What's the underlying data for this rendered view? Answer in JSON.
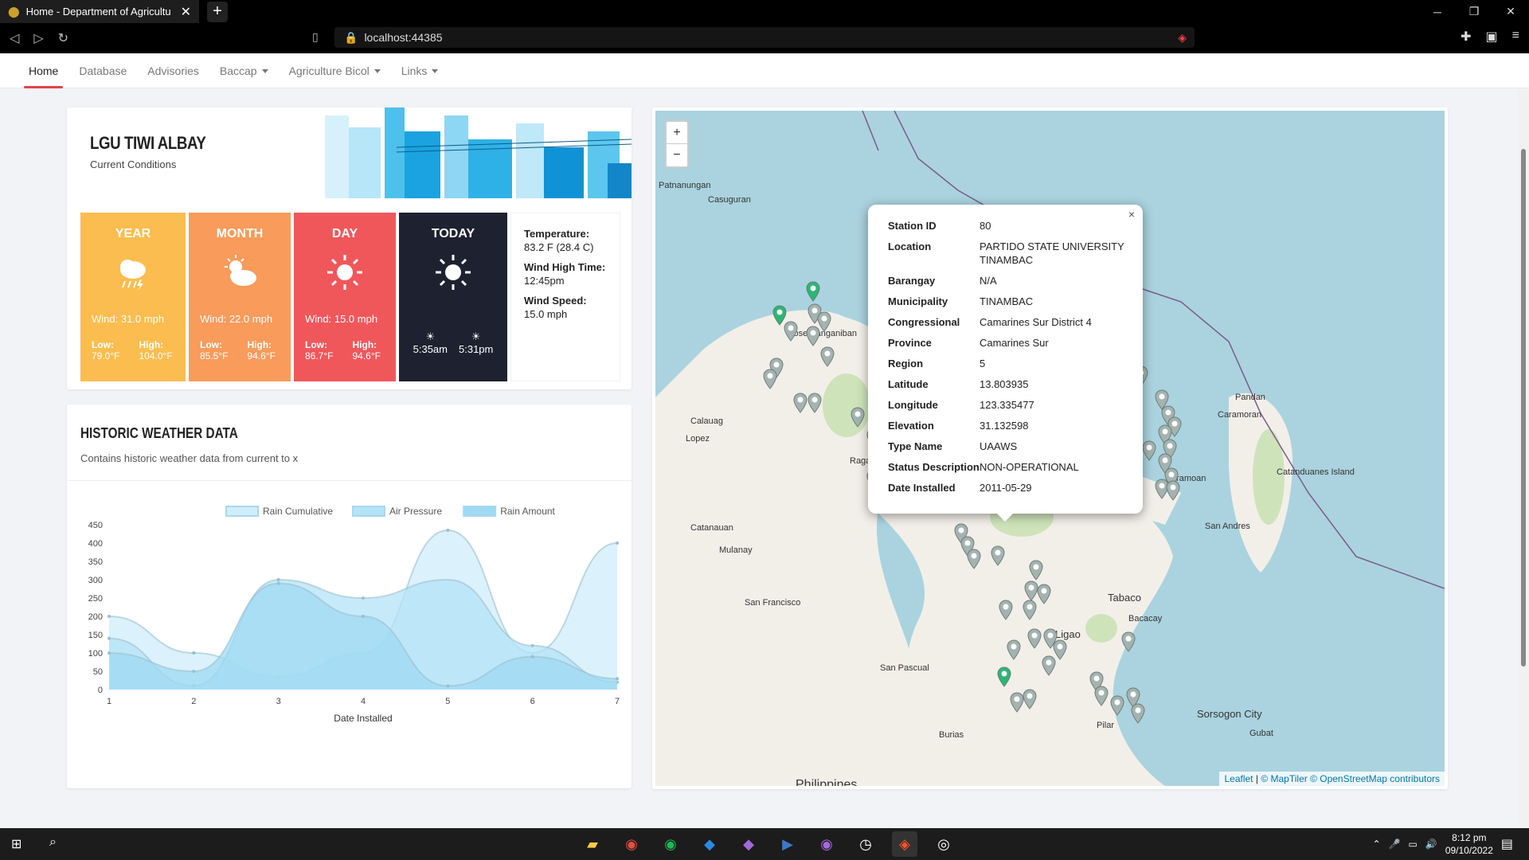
{
  "browser": {
    "tab_title": "Home - Department of Agricultu",
    "url": "localhost:44385"
  },
  "nav": {
    "items": [
      {
        "label": "Home"
      },
      {
        "label": "Database"
      },
      {
        "label": "Advisories"
      },
      {
        "label": "Baccap"
      },
      {
        "label": "Agriculture Bicol"
      },
      {
        "label": "Links"
      }
    ]
  },
  "lgu": {
    "title": "LGU TIWI ALBAY",
    "subtitle": "Current Conditions",
    "year": {
      "title": "YEAR",
      "wind": "Wind: 31.0 mph",
      "low_label": "Low:",
      "low": "79.0°F",
      "high_label": "High:",
      "high": "104.0°F"
    },
    "month": {
      "title": "MONTH",
      "wind": "Wind: 22.0 mph",
      "low_label": "Low:",
      "low": "85.5°F",
      "high_label": "High:",
      "high": "94.6°F"
    },
    "day": {
      "title": "DAY",
      "wind": "Wind: 15.0 mph",
      "low_label": "Low:",
      "low": "86.7°F",
      "high_label": "High:",
      "high": "94.6°F"
    },
    "today": {
      "title": "TODAY",
      "sunrise": "5:35am",
      "sunset": "5:31pm"
    },
    "stats": {
      "temp_label": "Temperature:",
      "temp": "83.2 F (28.4 C)",
      "wind_time_label": "Wind High Time:",
      "wind_time": "12:45pm",
      "wind_speed_label": "Wind Speed:",
      "wind_speed": "15.0 mph"
    }
  },
  "history": {
    "title": "HISTORIC WEATHER DATA",
    "subtitle": "Contains historic weather data from current to x"
  },
  "chart_data": {
    "type": "area",
    "x": [
      1,
      2,
      3,
      4,
      5,
      6,
      7
    ],
    "series": [
      {
        "name": "Rain Cumulative",
        "values": [
          200,
          100,
          35,
          100,
          435,
          100,
          400
        ]
      },
      {
        "name": "Air Pressure",
        "values": [
          140,
          10,
          300,
          250,
          300,
          120,
          20
        ]
      },
      {
        "name": "Rain Amount",
        "values": [
          100,
          50,
          290,
          200,
          10,
          90,
          30
        ]
      }
    ],
    "xlabel": "Date Installed",
    "ylabel": "",
    "ylim": [
      0,
      450
    ],
    "yticks": [
      0,
      50,
      100,
      150,
      200,
      250,
      300,
      350,
      400,
      450
    ],
    "legend": "top",
    "colors": [
      "#cfeefb",
      "#b3e3f7",
      "#9fd9f3"
    ]
  },
  "map": {
    "zoom_in": "+",
    "zoom_out": "−",
    "places": [
      "Patnanungan",
      "Casuguran",
      "Jose Panganiban",
      "Calauag",
      "Lopez",
      "Ragay",
      "Catanauan",
      "Mulanay",
      "San Francisco",
      "San Pascual",
      "Burias",
      "Ligao",
      "Tabaco",
      "Bacacay",
      "Caramoan",
      "Pandan",
      "Caramoran",
      "Catanduanes Island",
      "San Andres",
      "Sorsogon City",
      "Gubat",
      "Pilar",
      "Philippines"
    ],
    "attribution": {
      "leaflet": "Leaflet",
      "sep": "|",
      "maptiler": "© MapTiler",
      "osm": "© OpenStreetMap contributors"
    }
  },
  "popup": {
    "close": "×",
    "rows": [
      {
        "k": "Station ID",
        "v": "80"
      },
      {
        "k": "Location",
        "v": "PARTIDO STATE UNIVERSITY TINAMBAC"
      },
      {
        "k": "Barangay",
        "v": "N/A"
      },
      {
        "k": "Municipality",
        "v": "TINAMBAC"
      },
      {
        "k": "Congressional",
        "v": "Camarines Sur District 4"
      },
      {
        "k": "Province",
        "v": "Camarines Sur"
      },
      {
        "k": "Region",
        "v": "5"
      },
      {
        "k": "Latitude",
        "v": "13.803935"
      },
      {
        "k": "Longitude",
        "v": "123.335477"
      },
      {
        "k": "Elevation",
        "v": "31.132598"
      },
      {
        "k": "Type Name",
        "v": "UAAWS"
      },
      {
        "k": "Status Description",
        "v": "NON-OPERATIONAL"
      },
      {
        "k": "Date Installed",
        "v": "2011-05-29"
      }
    ]
  },
  "taskbar": {
    "time": "8:12 pm",
    "date": "09/10/2022"
  }
}
